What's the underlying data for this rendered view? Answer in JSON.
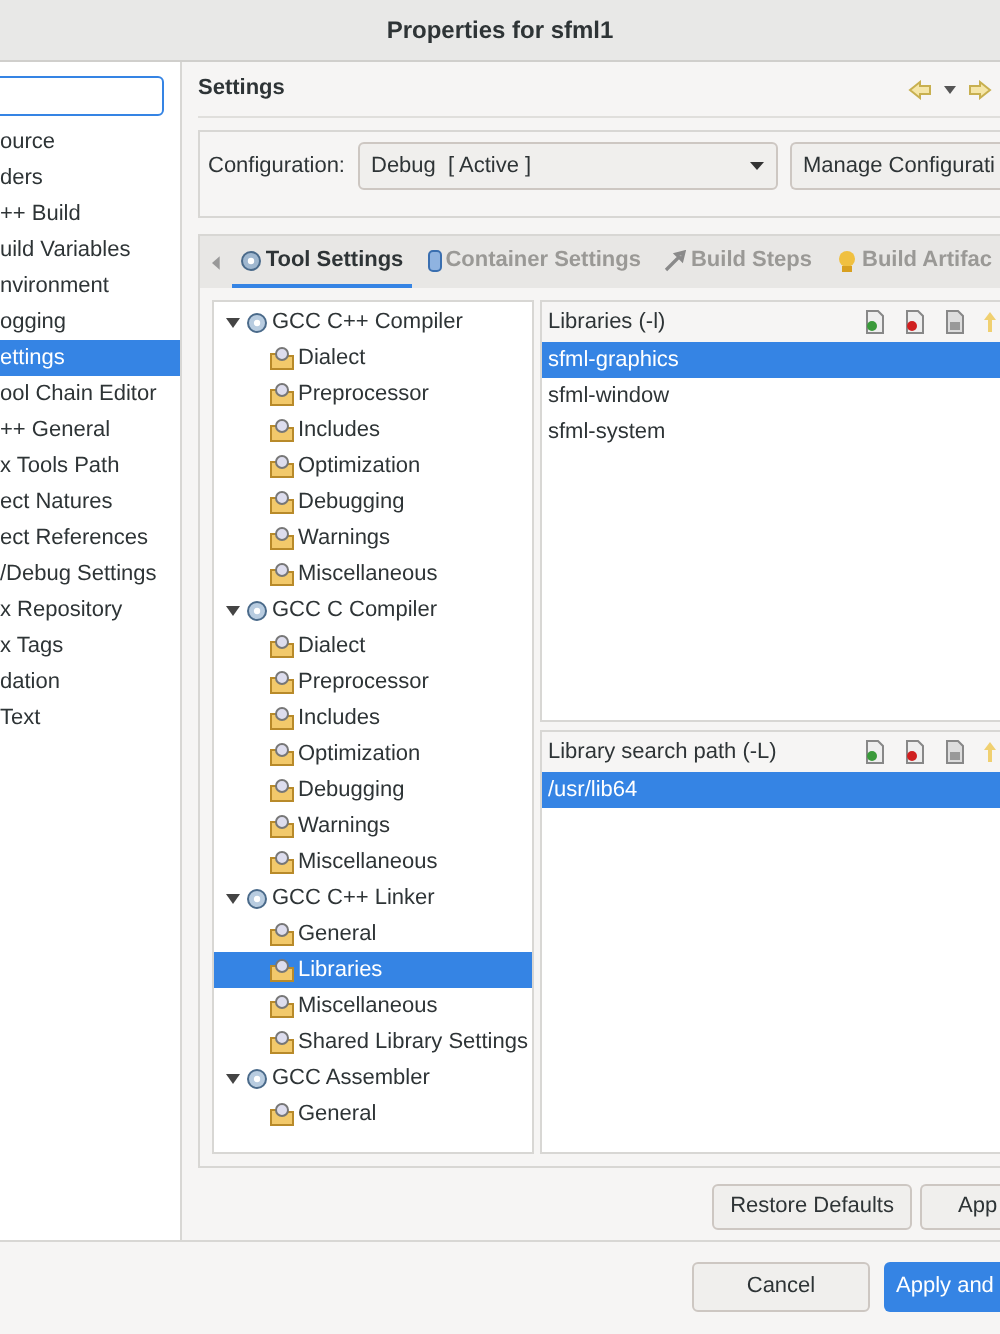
{
  "window": {
    "title": "Properties for sfml1"
  },
  "sidebar": {
    "items": [
      {
        "label": "ource",
        "selected": false
      },
      {
        "label": "ders",
        "selected": false
      },
      {
        "label": "++ Build",
        "selected": false
      },
      {
        "label": "uild Variables",
        "selected": false
      },
      {
        "label": "nvironment",
        "selected": false
      },
      {
        "label": "ogging",
        "selected": false
      },
      {
        "label": "ettings",
        "selected": true
      },
      {
        "label": "ool Chain Editor",
        "selected": false
      },
      {
        "label": "++ General",
        "selected": false
      },
      {
        "label": "x Tools Path",
        "selected": false
      },
      {
        "label": "ect Natures",
        "selected": false
      },
      {
        "label": "ect References",
        "selected": false
      },
      {
        "label": "/Debug Settings",
        "selected": false
      },
      {
        "label": "x Repository",
        "selected": false
      },
      {
        "label": "x Tags",
        "selected": false
      },
      {
        "label": "dation",
        "selected": false
      },
      {
        "label": "Text",
        "selected": false
      }
    ]
  },
  "page": {
    "title": "Settings",
    "configuration": {
      "label": "Configuration:",
      "value": "Debug  [ Active ]",
      "button": "Manage Configurati"
    },
    "tabs": [
      {
        "label": "Tool Settings",
        "selected": true,
        "kind": "tool"
      },
      {
        "label": "Container Settings",
        "selected": false,
        "kind": "container"
      },
      {
        "label": "Build Steps",
        "selected": false,
        "kind": "steps"
      },
      {
        "label": "Build Artifac",
        "selected": false,
        "kind": "artifact"
      }
    ],
    "tree": [
      {
        "label": "GCC C++ Compiler",
        "expanded": true,
        "selected": false,
        "children": [
          {
            "label": "Dialect",
            "selected": false
          },
          {
            "label": "Preprocessor",
            "selected": false
          },
          {
            "label": "Includes",
            "selected": false
          },
          {
            "label": "Optimization",
            "selected": false
          },
          {
            "label": "Debugging",
            "selected": false
          },
          {
            "label": "Warnings",
            "selected": false
          },
          {
            "label": "Miscellaneous",
            "selected": false
          }
        ]
      },
      {
        "label": "GCC C Compiler",
        "expanded": true,
        "selected": false,
        "children": [
          {
            "label": "Dialect",
            "selected": false
          },
          {
            "label": "Preprocessor",
            "selected": false
          },
          {
            "label": "Includes",
            "selected": false
          },
          {
            "label": "Optimization",
            "selected": false
          },
          {
            "label": "Debugging",
            "selected": false
          },
          {
            "label": "Warnings",
            "selected": false
          },
          {
            "label": "Miscellaneous",
            "selected": false
          }
        ]
      },
      {
        "label": "GCC C++ Linker",
        "expanded": true,
        "selected": false,
        "children": [
          {
            "label": "General",
            "selected": false
          },
          {
            "label": "Libraries",
            "selected": true
          },
          {
            "label": "Miscellaneous",
            "selected": false
          },
          {
            "label": "Shared Library Settings",
            "selected": false
          }
        ]
      },
      {
        "label": "GCC Assembler",
        "expanded": true,
        "selected": false,
        "children": [
          {
            "label": "General",
            "selected": false
          }
        ]
      }
    ],
    "lists": [
      {
        "title": "Libraries (-l)",
        "items": [
          {
            "label": "sfml-graphics",
            "selected": true
          },
          {
            "label": "sfml-window",
            "selected": false
          },
          {
            "label": "sfml-system",
            "selected": false
          }
        ]
      },
      {
        "title": "Library search path (-L)",
        "items": [
          {
            "label": "/usr/lib64",
            "selected": true
          }
        ]
      }
    ],
    "buttons": [
      "Restore Defaults",
      "App"
    ]
  },
  "footer": {
    "buttons": [
      {
        "label": "Cancel",
        "kind": "normal"
      },
      {
        "label": "Apply and",
        "kind": "primary"
      }
    ]
  }
}
